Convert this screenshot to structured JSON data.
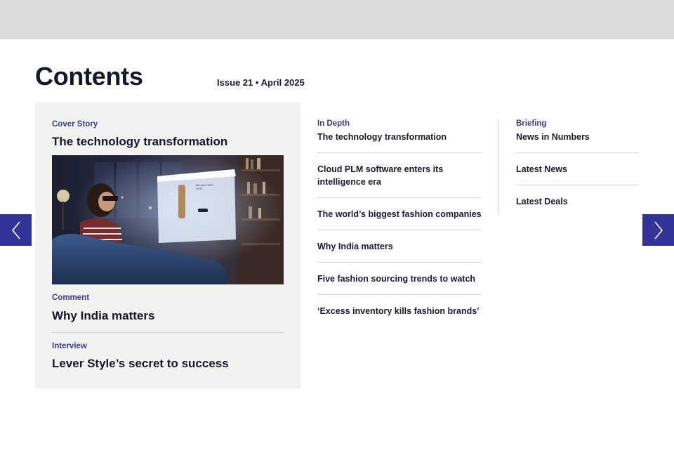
{
  "header": {
    "title": "Contents",
    "issue": "Issue 21 • April 2025"
  },
  "feature": {
    "cover": {
      "kicker": "Cover Story",
      "title": "The technology transformation"
    },
    "comment": {
      "kicker": "Comment",
      "title": "Why India matters"
    },
    "interview": {
      "kicker": "Interview",
      "title": "Lever Style’s secret to success"
    }
  },
  "in_depth": {
    "kicker": "In Depth",
    "items": [
      "The technology transformation",
      "Cloud PLM software enters its intelligence era",
      "The world’s biggest fashion companies",
      "Why India matters",
      "Five fashion sourcing trends to watch",
      "‘Excess inventory kills fashion brands’"
    ]
  },
  "briefing": {
    "kicker": "Briefing",
    "items": [
      "News in Numbers",
      "Latest News",
      "Latest Deals"
    ]
  },
  "hero_image_screen": {
    "brand": "MILANO EDIT",
    "sub": "2025"
  },
  "colors": {
    "accent": "#33349a",
    "kicker": "#3b3b8a",
    "panel": "#f2f2f1",
    "topbar": "#dcdcdc"
  },
  "icons": {
    "prev": "chevron-left-icon",
    "next": "chevron-right-icon"
  }
}
